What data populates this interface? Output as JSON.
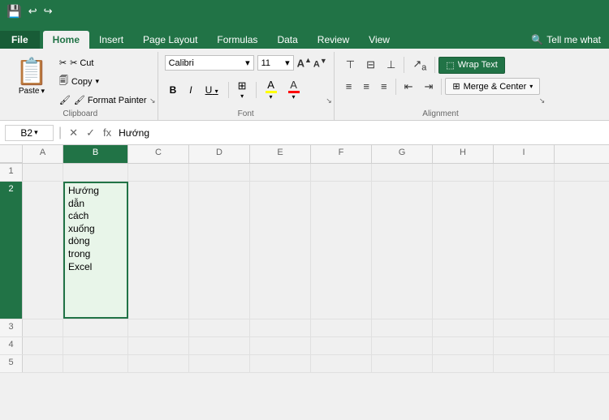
{
  "titlebar": {
    "save_icon": "💾",
    "undo_icon": "↩",
    "redo_icon": "↪"
  },
  "tabs": {
    "file": "File",
    "home": "Home",
    "insert": "Insert",
    "page_layout": "Page Layout",
    "formulas": "Formulas",
    "data": "Data",
    "review": "Review",
    "view": "View",
    "tell_me": "Tell me what",
    "tell_me_icon": "🔍"
  },
  "ribbon": {
    "clipboard": {
      "label": "Clipboard",
      "paste": "Paste",
      "cut": "✂ Cut",
      "copy": "🗐 Copy",
      "copy_arrow": "▾",
      "format_painter": "🖌 Format Painter"
    },
    "font": {
      "label": "Font",
      "name": "Calibri",
      "size": "11",
      "grow": "A▲",
      "shrink": "A▼",
      "bold": "B",
      "italic": "I",
      "underline": "U",
      "border": "⊞",
      "fill_color_label": "A",
      "font_color_label": "A",
      "expand": "↘"
    },
    "alignment": {
      "label": "Alignment",
      "top_align": "⊤",
      "mid_align": "≡",
      "bot_align": "⊥",
      "orientation": "↗",
      "indent_dec": "←",
      "indent_inc": "→",
      "left_align": "≡",
      "center_align": "≡",
      "right_align": "≡",
      "wrap_text": "Wrap Text",
      "merge_center": "Merge & Center",
      "wrap_icon": "⬚",
      "merge_icon": "⊞",
      "expand": "↘"
    }
  },
  "formula_bar": {
    "cell_ref": "B2",
    "cancel": "✕",
    "confirm": "✓",
    "fx": "fx",
    "value": "Hướng"
  },
  "spreadsheet": {
    "columns": [
      "A",
      "B",
      "C",
      "D",
      "E",
      "F",
      "G",
      "H",
      "I"
    ],
    "active_col": "B",
    "active_row": 2,
    "rows": [
      {
        "num": 1,
        "cells": [
          "",
          "",
          "",
          "",
          "",
          "",
          "",
          "",
          ""
        ]
      },
      {
        "num": 2,
        "cells": [
          "",
          "Hướng\ndẫn\ncách\nxuống\ndòng\ntrong\nExcel",
          "",
          "",
          "",
          "",
          "",
          "",
          ""
        ]
      },
      {
        "num": 3,
        "cells": [
          "",
          "",
          "",
          "",
          "",
          "",
          "",
          "",
          ""
        ]
      },
      {
        "num": 4,
        "cells": [
          "",
          "",
          "",
          "",
          "",
          "",
          "",
          "",
          ""
        ]
      },
      {
        "num": 5,
        "cells": [
          "",
          "",
          "",
          "",
          "",
          "",
          "",
          "",
          ""
        ]
      }
    ]
  }
}
